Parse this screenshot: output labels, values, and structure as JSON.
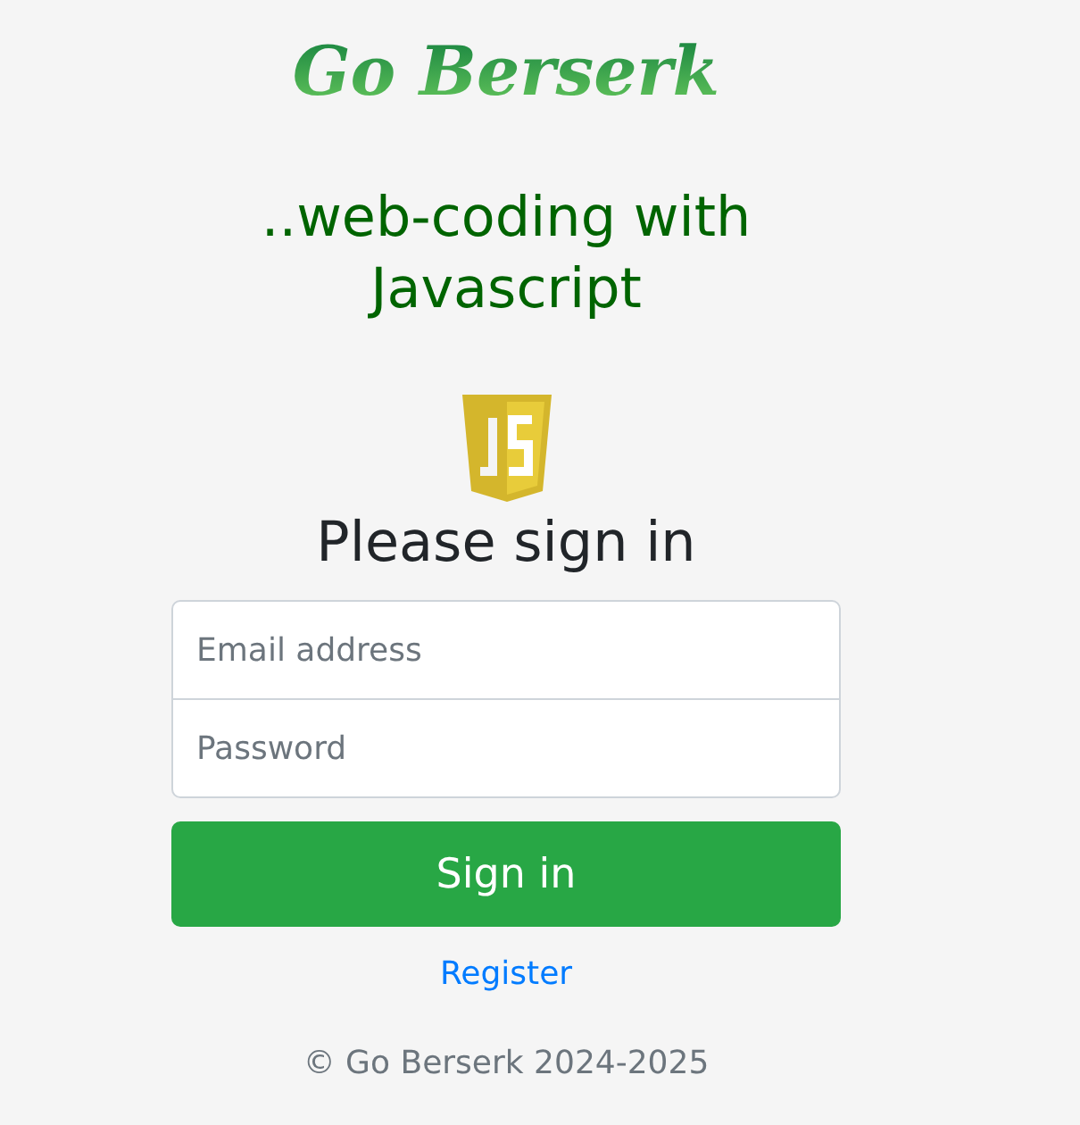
{
  "logo": {
    "text": "Go Berserk"
  },
  "tagline": "..web-coding with Javascript",
  "heading": "Please sign in",
  "fields": [
    {
      "placeholder": "Email address"
    },
    {
      "placeholder": "Password"
    }
  ],
  "submit": "Sign in",
  "register_link": "Register",
  "footer": "© Go Berserk 2024-2025"
}
